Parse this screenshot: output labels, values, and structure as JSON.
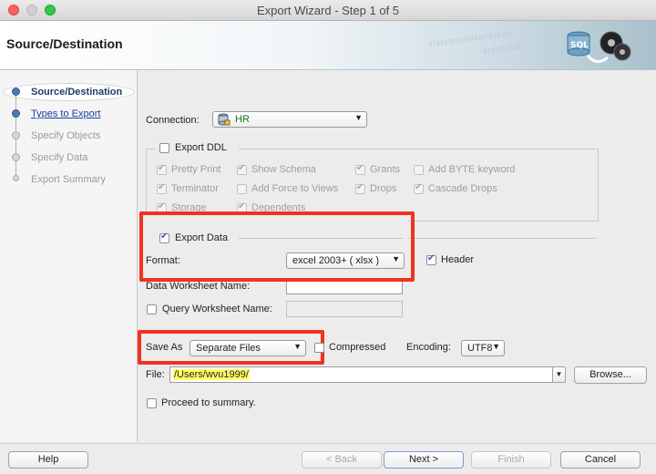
{
  "window": {
    "title": "Export Wizard - Step 1 of 5"
  },
  "header": {
    "title": "Source/Destination",
    "logo_label": "SQL"
  },
  "steps": [
    {
      "label": "Source/Destination",
      "state": "active"
    },
    {
      "label": "Types to Export",
      "state": "link"
    },
    {
      "label": "Specify Objects",
      "state": "disabled"
    },
    {
      "label": "Specify Data",
      "state": "disabled"
    },
    {
      "label": "Export Summary",
      "state": "disabled"
    }
  ],
  "connection": {
    "label": "Connection:",
    "value": "HR"
  },
  "export_ddl": {
    "label": "Export DDL",
    "checked": false,
    "options": {
      "pretty_print": "Pretty Print",
      "show_schema": "Show Schema",
      "grants": "Grants",
      "add_byte_keyword": "Add BYTE keyword",
      "terminator": "Terminator",
      "add_force_to_views": "Add Force to Views",
      "drops": "Drops",
      "cascade_drops": "Cascade Drops",
      "storage": "Storage",
      "dependents": "Dependents"
    }
  },
  "export_data": {
    "label": "Export Data",
    "checked": true,
    "format_label": "Format:",
    "format_value": "excel 2003+ ( xlsx )",
    "header_label": "Header",
    "header_checked": true,
    "data_worksheet_label": "Data Worksheet Name:",
    "data_worksheet_value": "",
    "query_worksheet_label": "Query Worksheet Name:",
    "query_worksheet_value": ""
  },
  "save_as": {
    "label": "Save As",
    "value": "Separate Files",
    "compressed_label": "Compressed",
    "encoding_label": "Encoding:",
    "encoding_value": "UTF8"
  },
  "file": {
    "label": "File:",
    "value": "/Users/wvu1999/",
    "browse_label": "Browse..."
  },
  "proceed": {
    "label": "Proceed to summary."
  },
  "footer": {
    "help": "Help",
    "back": "< Back",
    "next": "Next >",
    "finish": "Finish",
    "cancel": "Cancel"
  },
  "colors": {
    "highlight": "#ee3322",
    "accent": "#3a5ea8",
    "file_highlight": "#ffff66"
  }
}
